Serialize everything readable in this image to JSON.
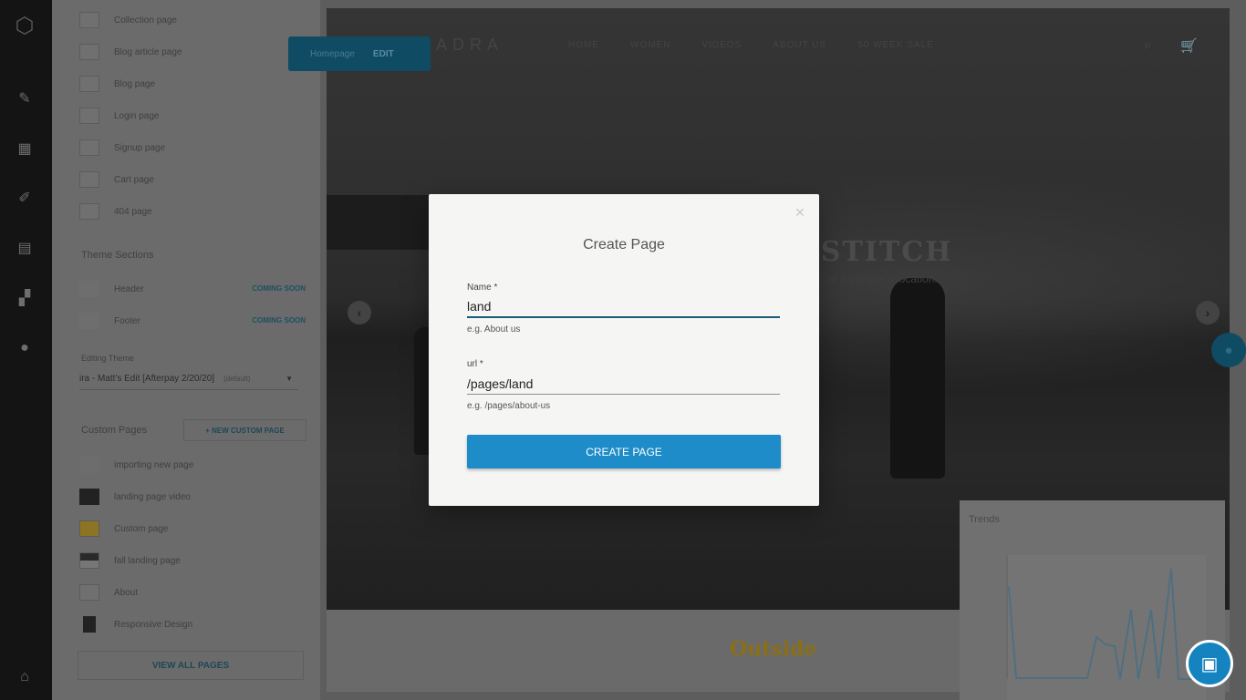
{
  "sidebar_rail": {
    "icons": [
      "cube-logo-icon",
      "magic-wand-icon",
      "grid-icon",
      "paint-brush-icon",
      "document-icon",
      "apps-icon",
      "user-icon",
      "bank-icon"
    ]
  },
  "panel": {
    "system_pages": [
      {
        "label": "Collection page"
      },
      {
        "label": "Blog article page"
      },
      {
        "label": "Blog page"
      },
      {
        "label": "Login page"
      },
      {
        "label": "Signup page"
      },
      {
        "label": "Cart page"
      },
      {
        "label": "404 page"
      }
    ],
    "theme_sections_title": "Theme Sections",
    "theme_sections": [
      {
        "label": "Header",
        "badge": "COMING SOON"
      },
      {
        "label": "Footer",
        "badge": "COMING SOON"
      }
    ],
    "editing_theme_label": "Editing Theme",
    "editing_theme_value": "ira - Matt's Edit [Afterpay 2/20/20]",
    "editing_theme_default": "(default)",
    "custom_pages_title": "Custom Pages",
    "new_custom_page_label": "+ NEW CUSTOM PAGE",
    "custom_pages": [
      {
        "label": "importing new page"
      },
      {
        "label": "landing page video"
      },
      {
        "label": "Custom page"
      },
      {
        "label": "fall landing page"
      },
      {
        "label": "About"
      },
      {
        "label": "Responsive Design"
      }
    ],
    "view_all_label": "VIEW ALL PAGES"
  },
  "highlight_tag": {
    "label": "Homepage",
    "edit": "EDIT"
  },
  "preview": {
    "brand": "ADRA",
    "nav_links": [
      "HOME",
      "WOMEN",
      "VIDEOS",
      "ABOUT US",
      "50 WEEK SALE"
    ],
    "hero_title": "RY STITCH",
    "hero_sub": "...at an angler's location.",
    "footer_logo": "Outside"
  },
  "trends": {
    "title": "Trends"
  },
  "modal": {
    "title": "Create Page",
    "name_label": "Name *",
    "name_value": "land",
    "name_hint": "e.g. About us",
    "url_label": "url *",
    "url_value": "/pages/land",
    "url_hint": "e.g. /pages/about-us",
    "submit_label": "CREATE PAGE",
    "close_icon": "close-icon"
  },
  "colors": {
    "accent": "#1d8cc9",
    "input_focus": "#1b5a75",
    "rail": "#141414"
  }
}
